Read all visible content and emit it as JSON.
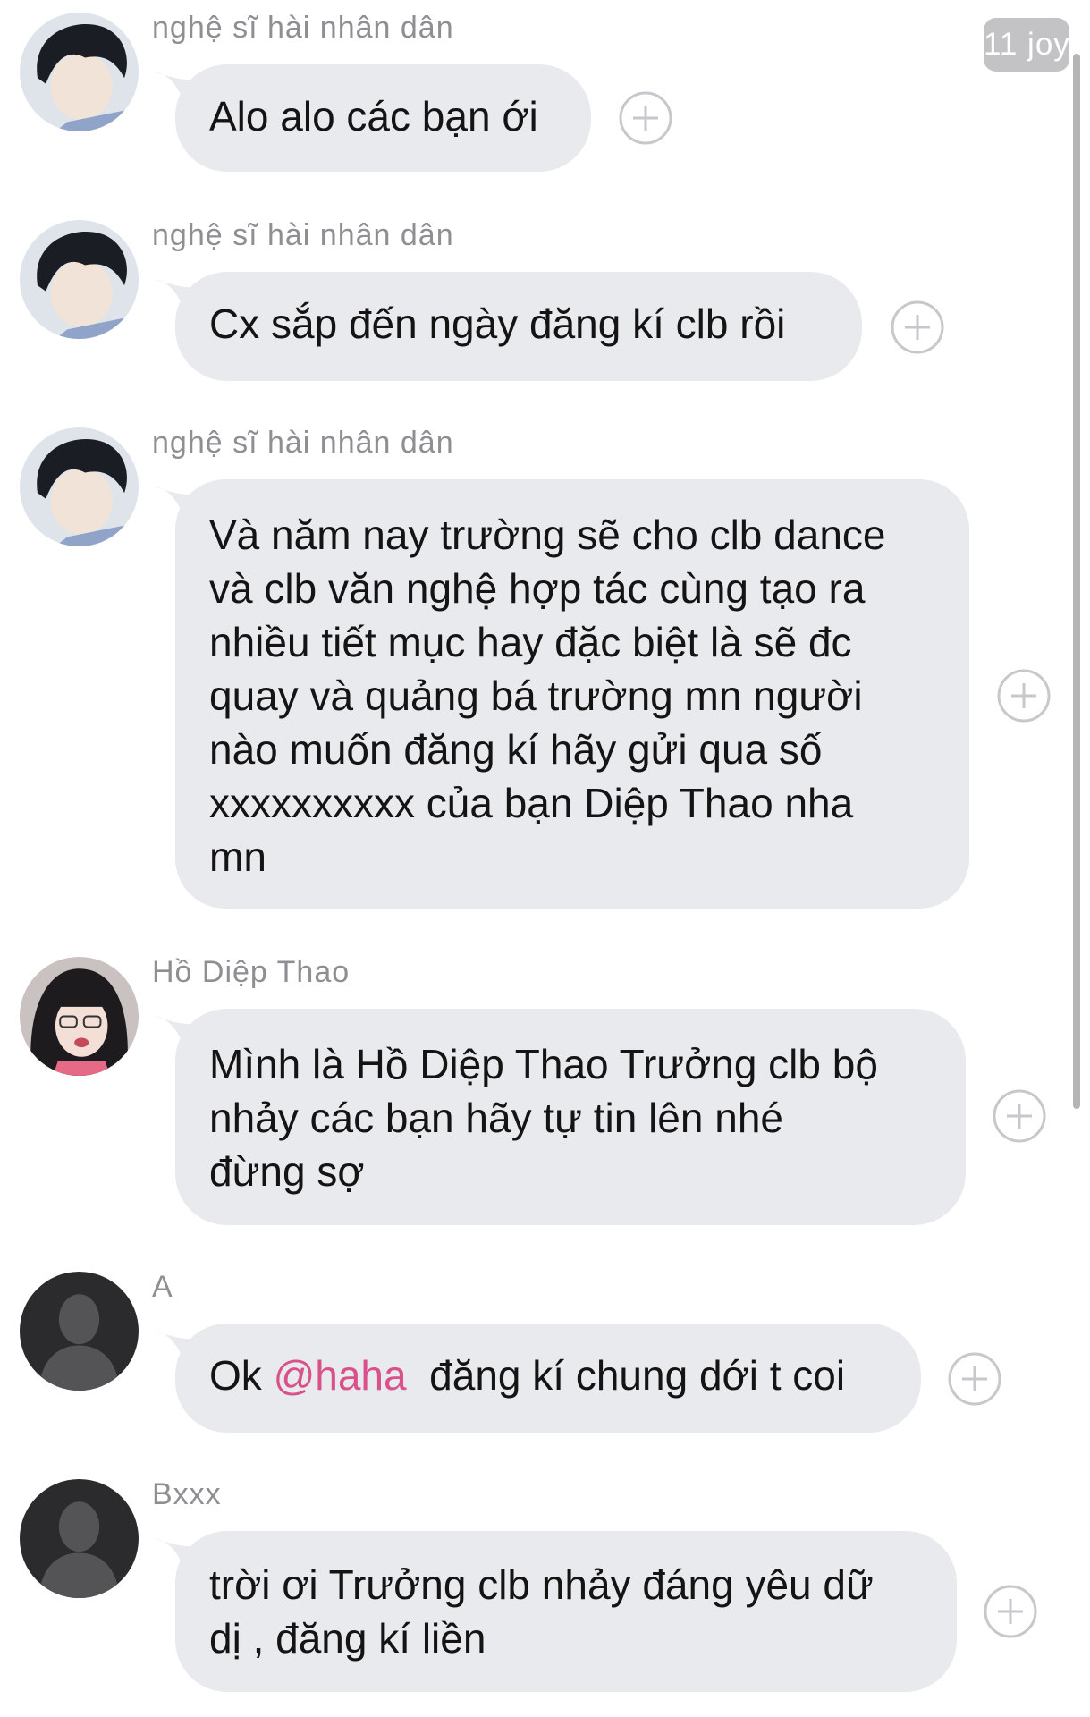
{
  "badge": {
    "text": "11 joy"
  },
  "messages": [
    {
      "sender": "nghệ sĩ hài nhân dân",
      "avatar": "avatar-boy-photo",
      "text": "Alo alo các bạn ới"
    },
    {
      "sender": "nghệ sĩ hài nhân dân",
      "avatar": "avatar-boy-photo",
      "text": "Cx sắp đến ngày đăng kí clb rồi"
    },
    {
      "sender": "nghệ sĩ hài nhân dân",
      "avatar": "avatar-boy-photo",
      "text": "Và năm nay trường sẽ cho clb dance\nvà clb văn nghệ hợp tác cùng tạo ra\nnhiều tiết mục hay đặc biệt là sẽ đc\nquay và quảng bá trường mn người\nnào muốn đăng kí hãy gửi qua số\nxxxxxxxxxx của bạn Diệp Thao nha\nmn"
    },
    {
      "sender": "Hồ Diệp Thao",
      "avatar": "avatar-girl-photo",
      "text": "Mình là Hồ Diệp Thao Trưởng clb bộ\nnhảy các bạn hãy tự tin lên nhé\nđừng sợ"
    },
    {
      "sender": "A",
      "avatar": "default-avatar-icon",
      "text_before": "Ok ",
      "mention": "@haha",
      "text_after": "  đăng kí chung dới t coi"
    },
    {
      "sender": "Bxxx",
      "avatar": "default-avatar-icon",
      "text": "trời ơi Trưởng clb nhảy đáng yêu dữ\ndị , đăng kí liền"
    }
  ],
  "colors": {
    "bubble": "#e9eaed",
    "sender_name": "#8e8e93",
    "mention": "#d9518a",
    "badge": "#c3c3c6"
  }
}
